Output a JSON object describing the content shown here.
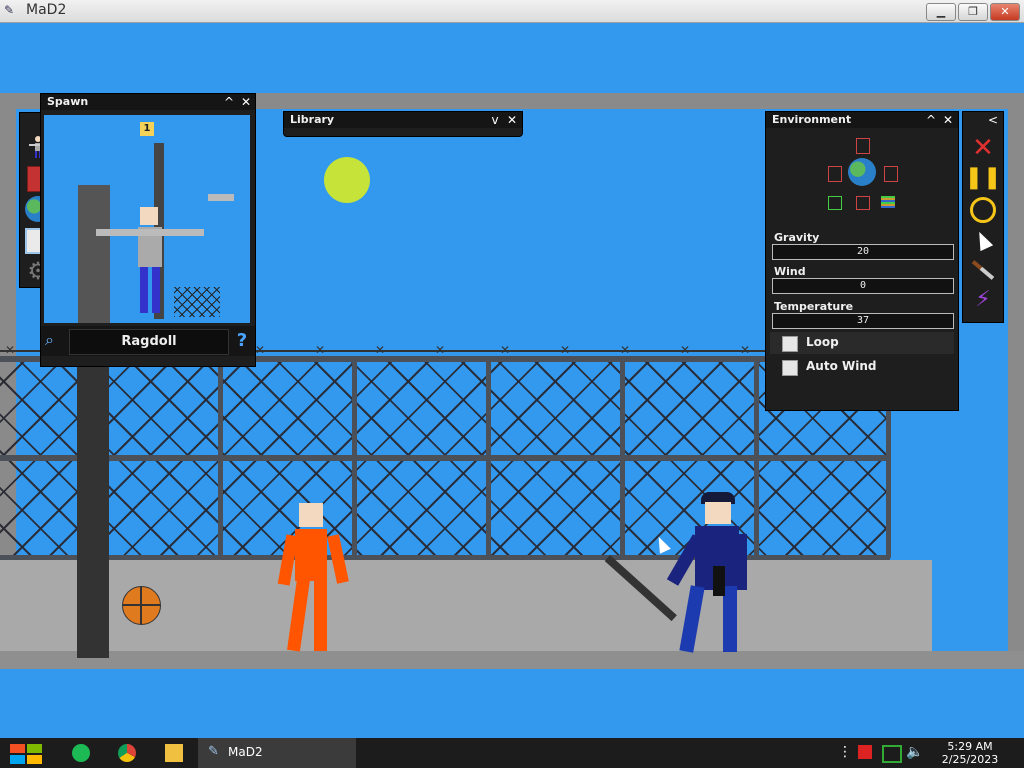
{
  "window": {
    "title": "MaD2",
    "minimize": "▁",
    "maximize": "❐",
    "close": "✕"
  },
  "spawn_panel": {
    "title": "Spawn",
    "collapse": "^",
    "close": "✕",
    "toggle": ">",
    "badge": "1",
    "label": "Ragdoll",
    "help": "?",
    "icons": [
      "ragdoll-icon",
      "book-icon",
      "globe-icon",
      "save-icon",
      "gear-icon"
    ]
  },
  "library_panel": {
    "title": "Library",
    "collapse": "v",
    "close": "✕"
  },
  "environment_panel": {
    "title": "Environment",
    "collapse": "^",
    "close": "✕",
    "gravity_label": "Gravity",
    "gravity_value": "20",
    "wind_label": "Wind",
    "wind_value": "0",
    "temperature_label": "Temperature",
    "temperature_value": "37",
    "loop_label": "Loop",
    "autowind_label": "Auto Wind"
  },
  "tools_panel": {
    "toggle": "<",
    "tools": [
      "delete-icon",
      "pause-icon",
      "stopwatch-icon",
      "cursor-icon",
      "knife-icon",
      "lightning-icon"
    ]
  },
  "taskbar": {
    "app_label": "MaD2",
    "time": "5:29 AM",
    "date": "2/25/2023"
  },
  "colors": {
    "sky": "#3399ee",
    "panel": "#1e1e1e",
    "prisoner": "#ff5500",
    "police": "#1a237e"
  }
}
